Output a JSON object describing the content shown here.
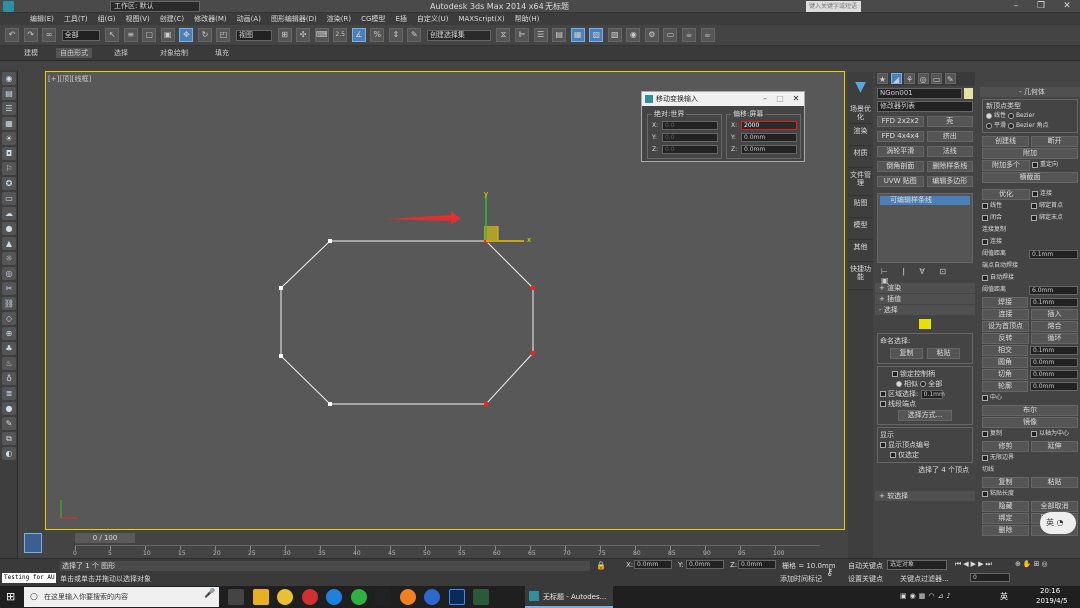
{
  "title": {
    "app": "Autodesk 3ds Max 2014 x64",
    "file": "无标题",
    "workspace": "工作区: 默认",
    "search_placeholder": "键入关键字或短语"
  },
  "menu": [
    "编辑(E)",
    "工具(T)",
    "组(G)",
    "视图(V)",
    "创建(C)",
    "修改器(M)",
    "动画(A)",
    "图形编辑器(D)",
    "渲染(R)",
    "CG模型",
    "E插",
    "自定义(U)",
    "MAXScript(X)",
    "帮助(H)"
  ],
  "toolbar": {
    "filter": "全部",
    "refcoord": "视图",
    "snap": "2.5",
    "named_sel": "创建选择集"
  },
  "ribbon": [
    "建模",
    "自由形式",
    "选择",
    "对象绘制",
    "填充"
  ],
  "viewport": {
    "label": "[+][顶][线框]",
    "axis_x": "x",
    "axis_y": "y"
  },
  "dialog": {
    "title": "移动变换输入",
    "left_group": "绝对:世界",
    "right_group": "偏移:屏幕",
    "left": [
      {
        "axis": "X:",
        "value": "0.0"
      },
      {
        "axis": "Y:",
        "value": "0.0"
      },
      {
        "axis": "Z:",
        "value": "0.0"
      }
    ],
    "right": [
      {
        "axis": "X:",
        "value": "2000"
      },
      {
        "axis": "Y:",
        "value": "0.0mm"
      },
      {
        "axis": "Z:",
        "value": "0.0mm"
      }
    ]
  },
  "cmdtabs": [
    "场景优化",
    "渲染",
    "材质",
    "文件管理",
    "贴图",
    "模型",
    "其他",
    "快捷功能"
  ],
  "cmdpanel": {
    "object_name": "NGon001",
    "modifier_list": "修改器列表",
    "mod_buttons": [
      [
        "FFD 2x2x2",
        "壳"
      ],
      [
        "FFD 4x4x4",
        "挤出"
      ],
      [
        "涡轮平滑",
        "法线"
      ],
      [
        "倒角剖面",
        "删除样条线"
      ],
      [
        "UVW 贴图",
        "编辑多边形"
      ]
    ],
    "stack_item": "可编辑样条线",
    "rollouts": [
      "渲染",
      "插值",
      "选择"
    ],
    "named_sel_label": "命名选择:",
    "copy_btn": "复制",
    "paste_btn": "粘贴",
    "lock_handles": "锁定控制柄",
    "similar": "相似",
    "all": "全部",
    "area_sel": "区域选择:",
    "area_val": "0.1mm",
    "segment_end": "线段端点",
    "sel_method": "选择方式...",
    "display_label": "显示",
    "show_vertex_num": "显示顶点编号",
    "selected_only": "仅选定",
    "sel_status": "选择了 4 个顶点",
    "soft_sel": "软选择"
  },
  "rightpanel": {
    "geometry": "几何体",
    "new_vertex_type": "新顶点类型",
    "linear": "线性",
    "bezier": "Bezier",
    "smooth": "平滑",
    "bezier_corner": "Bezier 角点",
    "create_line": "创建线",
    "break": "断开",
    "attach": "附加",
    "attach_multi": "附加多个",
    "reorient": "重定向",
    "cross_section": "横截面",
    "refine": "优化",
    "connect": "连接",
    "linear2": "线性",
    "bind_first": "绑定首点",
    "closed": "闭合",
    "bind_last": "绑定末点",
    "connect_copy": "连接复制",
    "connect2": "连接",
    "threshold": "阈值距离",
    "threshold_val": "0.1mm",
    "auto_weld": "端点自动焊接",
    "auto_weld2": "自动焊接",
    "threshold2": "阈值距离",
    "threshold2_val": "6.0mm",
    "weld": "焊接",
    "weld_val": "0.1mm",
    "connect3": "连接",
    "insert": "插入",
    "make_first": "设为首顶点",
    "fuse": "熔合",
    "reverse": "反转",
    "cycle": "循环",
    "crossinsert": "相交",
    "cross_val": "0.1mm",
    "fillet": "圆角",
    "fillet_val": "0.0mm",
    "chamfer": "切角",
    "chamfer_val": "0.0mm",
    "outline": "轮廓",
    "outline_val": "0.0mm",
    "center": "中心",
    "boolean": "布尔",
    "mirror": "镜像",
    "copy": "复制",
    "about_pivot": "以轴为中心",
    "trim": "修剪",
    "extend": "延伸",
    "infinite": "无限边界",
    "tangent": "切线",
    "tcopy": "复制",
    "tpaste": "粘贴",
    "paste_length": "粘贴长度",
    "hide": "隐藏",
    "unhide": "全部取消",
    "bind": "绑定",
    "unbind": "取消绑定",
    "delete": "删除",
    "close": "关闭",
    "badge": "英"
  },
  "timeline": {
    "frame": "0 / 100",
    "ticks": [
      "0",
      "5",
      "10",
      "15",
      "20",
      "25",
      "30",
      "35",
      "40",
      "45",
      "50",
      "55",
      "60",
      "65",
      "70",
      "75",
      "80",
      "85",
      "90",
      "95",
      "100"
    ]
  },
  "status": {
    "script": "Testing for AU",
    "msg1": "选择了 1 个 图形",
    "msg2": "单击或单击并拖动以选择对象",
    "x_label": "X:",
    "x_val": "0.0mm",
    "y_label": "Y:",
    "y_val": "0.0mm",
    "z_label": "Z:",
    "z_val": "0.0mm",
    "grid": "栅格 = 10.0mm",
    "add_time_tag": "添加时间标记",
    "auto_key": "自动关键点",
    "selected_obj": "选定对象",
    "set_key": "设置关键点",
    "key_filter": "关键点过滤器...",
    "frame_val": "0"
  },
  "taskbar": {
    "search": "在这里输入你要搜索的内容",
    "active_app": "无标题 - Autodes...",
    "time": "20:16",
    "date": "2019/4/5",
    "ime": "英"
  },
  "colors": {
    "accent": "#e8d200",
    "selected_btn": "#4a7fb8",
    "arrow": "#e03030",
    "vertex": "#ff2020"
  }
}
